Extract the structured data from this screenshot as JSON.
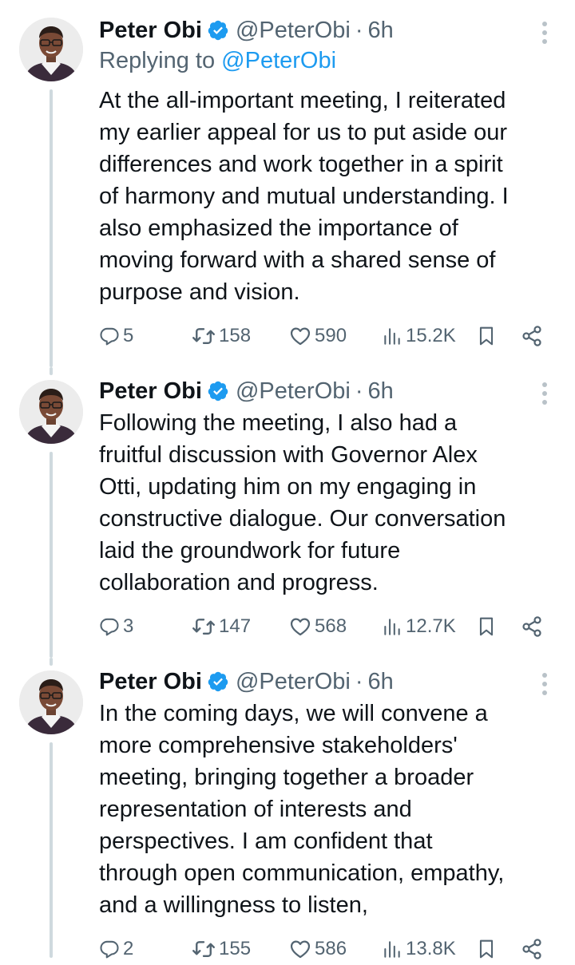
{
  "tweets": [
    {
      "author": {
        "name": "Peter Obi",
        "handle": "@PeterObi",
        "avatar_icon": "profile-photo"
      },
      "separator": "·",
      "time": "6h",
      "replying_prefix": "Replying to",
      "replying_handle": "@PeterObi",
      "text": "At the all-important meeting, I reiterated\nmy earlier appeal for us to put aside our\ndifferences and work together in a spirit\nof harmony and mutual understanding. I\nalso emphasized the importance of\nmoving forward with a shared sense of\npurpose and vision.",
      "replies": "5",
      "retweets": "158",
      "likes": "590",
      "views": "15.2K"
    },
    {
      "author": {
        "name": "Peter Obi",
        "handle": "@PeterObi",
        "avatar_icon": "profile-photo"
      },
      "separator": "·",
      "time": "6h",
      "text": "Following the meeting, I also had a\nfruitful discussion with Governor Alex\nOtti, updating him on my engaging in\nconstructive dialogue. Our conversation\nlaid the groundwork for future\ncollaboration and progress.",
      "replies": "3",
      "retweets": "147",
      "likes": "568",
      "views": "12.7K"
    },
    {
      "author": {
        "name": "Peter Obi",
        "handle": "@PeterObi",
        "avatar_icon": "profile-photo"
      },
      "separator": "·",
      "time": "6h",
      "text": "In the coming days, we will convene a\nmore comprehensive stakeholders'\nmeeting, bringing together a broader\nrepresentation of interests and\nperspectives. I am confident that\nthrough open communication, empathy,\nand a willingness to listen,",
      "replies": "2",
      "retweets": "155",
      "likes": "586",
      "views": "13.8K"
    }
  ],
  "icons": {
    "verified": "verified-badge-icon",
    "more": "more-vertical-icon",
    "reply": "reply-icon",
    "retweet": "retweet-icon",
    "like": "heart-icon",
    "views": "views-icon",
    "bookmark": "bookmark-icon",
    "share": "share-icon"
  },
  "colors": {
    "text": "#0f1419",
    "secondary": "#536471",
    "accent": "#1d9bf0",
    "thread_line": "#cfd9de"
  }
}
